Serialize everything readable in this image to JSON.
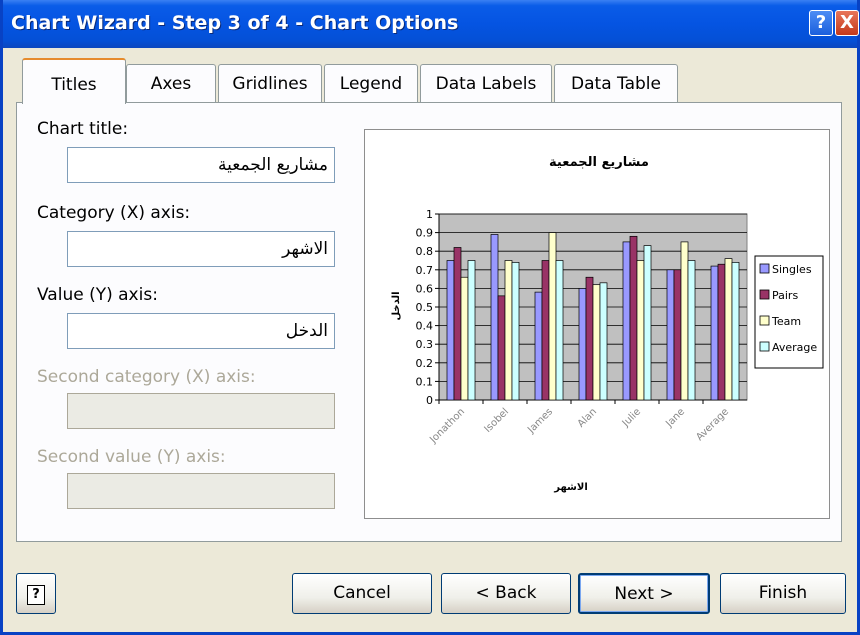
{
  "window": {
    "title": "Chart Wizard - Step 3 of 4 - Chart Options",
    "help_btn": "?",
    "close_btn": "X"
  },
  "tabs": [
    {
      "label": "Titles",
      "active": true
    },
    {
      "label": "Axes"
    },
    {
      "label": "Gridlines"
    },
    {
      "label": "Legend"
    },
    {
      "label": "Data Labels"
    },
    {
      "label": "Data Table"
    }
  ],
  "form": {
    "chart_title_label": "Chart title:",
    "chart_title_value": "مشاريع الجمعية",
    "category_label": "Category (X) axis:",
    "category_value": "الاشهر",
    "value_label": "Value (Y) axis:",
    "value_value": "الدخل",
    "second_category_label": "Second category (X) axis:",
    "second_value_label": "Second value (Y) axis:"
  },
  "chart_data": {
    "type": "bar",
    "title": "مشاريع الجمعية",
    "xlabel": "الاشهر",
    "ylabel": "الدخل",
    "ylim": [
      0,
      1
    ],
    "yticks": [
      0,
      0.1,
      0.2,
      0.3,
      0.4,
      0.5,
      0.6,
      0.7,
      0.8,
      0.9,
      1
    ],
    "categories": [
      "Jonathon",
      "Isobel",
      "James",
      "Alan",
      "Julie",
      "Jane",
      "Average"
    ],
    "series": [
      {
        "name": "Singles",
        "color": "#9999FF",
        "values": [
          0.75,
          0.89,
          0.58,
          0.6,
          0.85,
          0.7,
          0.72
        ]
      },
      {
        "name": "Pairs",
        "color": "#993366",
        "values": [
          0.82,
          0.56,
          0.75,
          0.66,
          0.88,
          0.7,
          0.73
        ]
      },
      {
        "name": "Team",
        "color": "#FFFFCC",
        "values": [
          0.66,
          0.75,
          0.9,
          0.62,
          0.75,
          0.85,
          0.76
        ]
      },
      {
        "name": "Average",
        "color": "#CCFFFF",
        "values": [
          0.75,
          0.74,
          0.75,
          0.63,
          0.83,
          0.75,
          0.74
        ]
      }
    ],
    "plot_bg": "#C0C0C0",
    "grid": true,
    "legend_position": "right"
  },
  "buttons": {
    "help": "?",
    "cancel": "Cancel",
    "back": "< Back",
    "next": "Next >",
    "finish": "Finish"
  },
  "colors": {
    "titlebar": "#0554E2",
    "active_tab_accent": "#E68B2C",
    "dialog_bg": "#ECE9D8"
  }
}
